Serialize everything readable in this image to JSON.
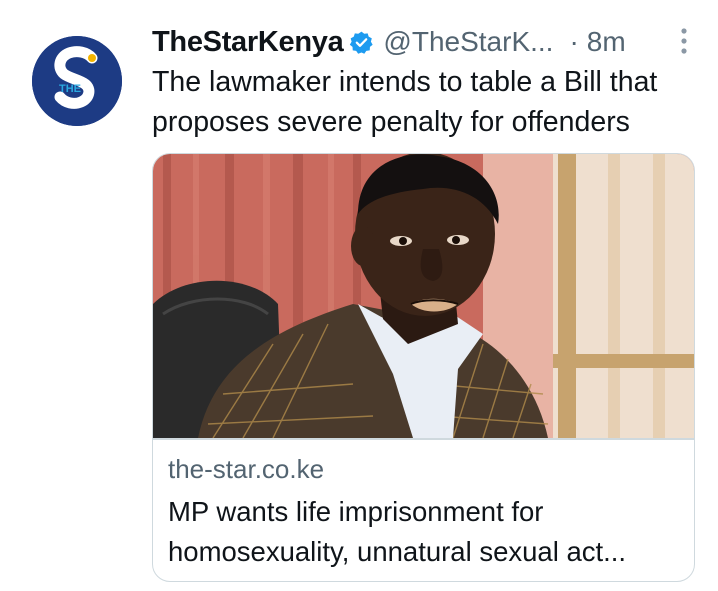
{
  "tweet": {
    "author": {
      "display_name": "TheStarKenya",
      "verified": true,
      "handle": "@TheStarK...",
      "avatar_icon": "the-star-logo-icon",
      "avatar_text": "THE"
    },
    "separator": "·",
    "time": "8m",
    "text_lines": [
      "The lawmaker intends to table a Bill that",
      "proposes severe penalty for offenders"
    ]
  },
  "card": {
    "domain": "the-star.co.ke",
    "title_lines": [
      "MP wants life imprisonment for",
      "homosexuality, unnatural sexual act..."
    ]
  },
  "colors": {
    "text_primary": "#0f1419",
    "text_secondary": "#536471",
    "verified_blue": "#1d9bf0",
    "avatar_bg": "#1d3b84",
    "border": "#cfd9de"
  }
}
